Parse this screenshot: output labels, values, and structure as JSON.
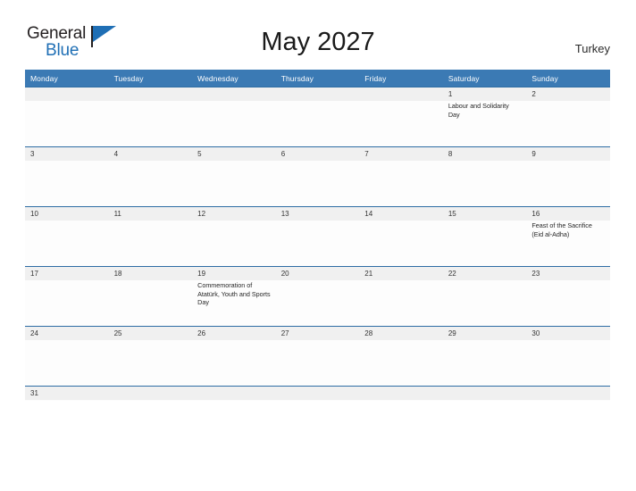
{
  "brand": {
    "name_part1": "General",
    "name_part2": "Blue",
    "flag_icon": "flag-triangle-icon",
    "color_primary": "#1f6fb5",
    "color_text": "#231f20"
  },
  "header": {
    "title": "May 2027",
    "country": "Turkey"
  },
  "theme": {
    "header_blue": "#3b7ab4",
    "row_divider_blue": "#2e6da4",
    "date_band_gray": "#f0f0f0",
    "cell_white": "#fdfdfd",
    "text_dark": "#262626"
  },
  "calendar": {
    "month": "May",
    "year": "2027",
    "weekday_headers": [
      "Monday",
      "Tuesday",
      "Wednesday",
      "Thursday",
      "Friday",
      "Saturday",
      "Sunday"
    ],
    "weeks": [
      [
        {
          "date": "",
          "events": []
        },
        {
          "date": "",
          "events": []
        },
        {
          "date": "",
          "events": []
        },
        {
          "date": "",
          "events": []
        },
        {
          "date": "",
          "events": []
        },
        {
          "date": "1",
          "events": [
            "Labour and Solidarity Day"
          ]
        },
        {
          "date": "2",
          "events": []
        }
      ],
      [
        {
          "date": "3",
          "events": []
        },
        {
          "date": "4",
          "events": []
        },
        {
          "date": "5",
          "events": []
        },
        {
          "date": "6",
          "events": []
        },
        {
          "date": "7",
          "events": []
        },
        {
          "date": "8",
          "events": []
        },
        {
          "date": "9",
          "events": []
        }
      ],
      [
        {
          "date": "10",
          "events": []
        },
        {
          "date": "11",
          "events": []
        },
        {
          "date": "12",
          "events": []
        },
        {
          "date": "13",
          "events": []
        },
        {
          "date": "14",
          "events": []
        },
        {
          "date": "15",
          "events": []
        },
        {
          "date": "16",
          "events": [
            "Feast of the Sacrifice (Eid al-Adha)"
          ]
        }
      ],
      [
        {
          "date": "17",
          "events": []
        },
        {
          "date": "18",
          "events": []
        },
        {
          "date": "19",
          "events": [
            "Commemoration of Atatürk, Youth and Sports Day"
          ]
        },
        {
          "date": "20",
          "events": []
        },
        {
          "date": "21",
          "events": []
        },
        {
          "date": "22",
          "events": []
        },
        {
          "date": "23",
          "events": []
        }
      ],
      [
        {
          "date": "24",
          "events": []
        },
        {
          "date": "25",
          "events": []
        },
        {
          "date": "26",
          "events": []
        },
        {
          "date": "27",
          "events": []
        },
        {
          "date": "28",
          "events": []
        },
        {
          "date": "29",
          "events": []
        },
        {
          "date": "30",
          "events": []
        }
      ],
      [
        {
          "date": "31",
          "events": []
        },
        {
          "date": "",
          "events": []
        },
        {
          "date": "",
          "events": []
        },
        {
          "date": "",
          "events": []
        },
        {
          "date": "",
          "events": []
        },
        {
          "date": "",
          "events": []
        },
        {
          "date": "",
          "events": []
        }
      ]
    ]
  }
}
